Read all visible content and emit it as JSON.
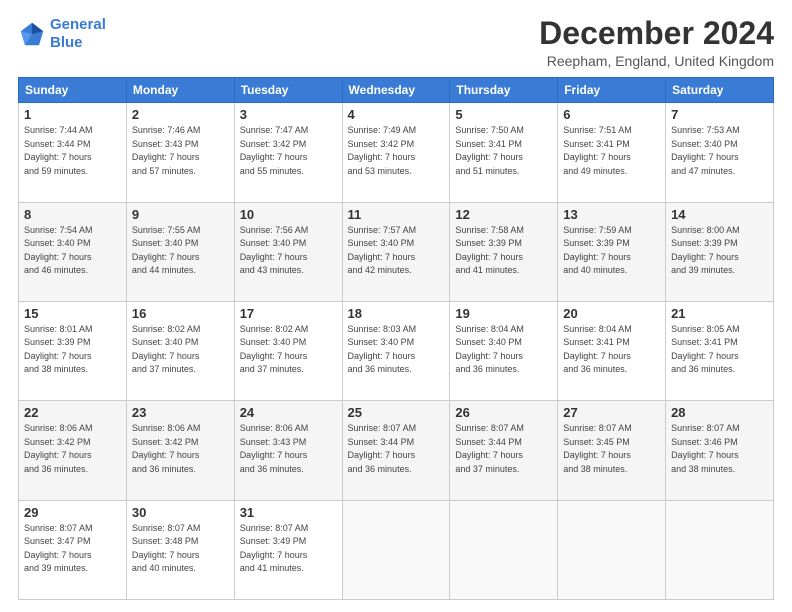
{
  "header": {
    "logo_line1": "General",
    "logo_line2": "Blue",
    "main_title": "December 2024",
    "subtitle": "Reepham, England, United Kingdom"
  },
  "days_of_week": [
    "Sunday",
    "Monday",
    "Tuesday",
    "Wednesday",
    "Thursday",
    "Friday",
    "Saturday"
  ],
  "weeks": [
    [
      {
        "day": "1",
        "sunrise": "7:44 AM",
        "sunset": "3:44 PM",
        "daylight": "7 hours and 59 minutes."
      },
      {
        "day": "2",
        "sunrise": "7:46 AM",
        "sunset": "3:43 PM",
        "daylight": "7 hours and 57 minutes."
      },
      {
        "day": "3",
        "sunrise": "7:47 AM",
        "sunset": "3:42 PM",
        "daylight": "7 hours and 55 minutes."
      },
      {
        "day": "4",
        "sunrise": "7:49 AM",
        "sunset": "3:42 PM",
        "daylight": "7 hours and 53 minutes."
      },
      {
        "day": "5",
        "sunrise": "7:50 AM",
        "sunset": "3:41 PM",
        "daylight": "7 hours and 51 minutes."
      },
      {
        "day": "6",
        "sunrise": "7:51 AM",
        "sunset": "3:41 PM",
        "daylight": "7 hours and 49 minutes."
      },
      {
        "day": "7",
        "sunrise": "7:53 AM",
        "sunset": "3:40 PM",
        "daylight": "7 hours and 47 minutes."
      }
    ],
    [
      {
        "day": "8",
        "sunrise": "7:54 AM",
        "sunset": "3:40 PM",
        "daylight": "7 hours and 46 minutes."
      },
      {
        "day": "9",
        "sunrise": "7:55 AM",
        "sunset": "3:40 PM",
        "daylight": "7 hours and 44 minutes."
      },
      {
        "day": "10",
        "sunrise": "7:56 AM",
        "sunset": "3:40 PM",
        "daylight": "7 hours and 43 minutes."
      },
      {
        "day": "11",
        "sunrise": "7:57 AM",
        "sunset": "3:40 PM",
        "daylight": "7 hours and 42 minutes."
      },
      {
        "day": "12",
        "sunrise": "7:58 AM",
        "sunset": "3:39 PM",
        "daylight": "7 hours and 41 minutes."
      },
      {
        "day": "13",
        "sunrise": "7:59 AM",
        "sunset": "3:39 PM",
        "daylight": "7 hours and 40 minutes."
      },
      {
        "day": "14",
        "sunrise": "8:00 AM",
        "sunset": "3:39 PM",
        "daylight": "7 hours and 39 minutes."
      }
    ],
    [
      {
        "day": "15",
        "sunrise": "8:01 AM",
        "sunset": "3:39 PM",
        "daylight": "7 hours and 38 minutes."
      },
      {
        "day": "16",
        "sunrise": "8:02 AM",
        "sunset": "3:40 PM",
        "daylight": "7 hours and 37 minutes."
      },
      {
        "day": "17",
        "sunrise": "8:02 AM",
        "sunset": "3:40 PM",
        "daylight": "7 hours and 37 minutes."
      },
      {
        "day": "18",
        "sunrise": "8:03 AM",
        "sunset": "3:40 PM",
        "daylight": "7 hours and 36 minutes."
      },
      {
        "day": "19",
        "sunrise": "8:04 AM",
        "sunset": "3:40 PM",
        "daylight": "7 hours and 36 minutes."
      },
      {
        "day": "20",
        "sunrise": "8:04 AM",
        "sunset": "3:41 PM",
        "daylight": "7 hours and 36 minutes."
      },
      {
        "day": "21",
        "sunrise": "8:05 AM",
        "sunset": "3:41 PM",
        "daylight": "7 hours and 36 minutes."
      }
    ],
    [
      {
        "day": "22",
        "sunrise": "8:06 AM",
        "sunset": "3:42 PM",
        "daylight": "7 hours and 36 minutes."
      },
      {
        "day": "23",
        "sunrise": "8:06 AM",
        "sunset": "3:42 PM",
        "daylight": "7 hours and 36 minutes."
      },
      {
        "day": "24",
        "sunrise": "8:06 AM",
        "sunset": "3:43 PM",
        "daylight": "7 hours and 36 minutes."
      },
      {
        "day": "25",
        "sunrise": "8:07 AM",
        "sunset": "3:44 PM",
        "daylight": "7 hours and 36 minutes."
      },
      {
        "day": "26",
        "sunrise": "8:07 AM",
        "sunset": "3:44 PM",
        "daylight": "7 hours and 37 minutes."
      },
      {
        "day": "27",
        "sunrise": "8:07 AM",
        "sunset": "3:45 PM",
        "daylight": "7 hours and 38 minutes."
      },
      {
        "day": "28",
        "sunrise": "8:07 AM",
        "sunset": "3:46 PM",
        "daylight": "7 hours and 38 minutes."
      }
    ],
    [
      {
        "day": "29",
        "sunrise": "8:07 AM",
        "sunset": "3:47 PM",
        "daylight": "7 hours and 39 minutes."
      },
      {
        "day": "30",
        "sunrise": "8:07 AM",
        "sunset": "3:48 PM",
        "daylight": "7 hours and 40 minutes."
      },
      {
        "day": "31",
        "sunrise": "8:07 AM",
        "sunset": "3:49 PM",
        "daylight": "7 hours and 41 minutes."
      },
      null,
      null,
      null,
      null
    ]
  ]
}
